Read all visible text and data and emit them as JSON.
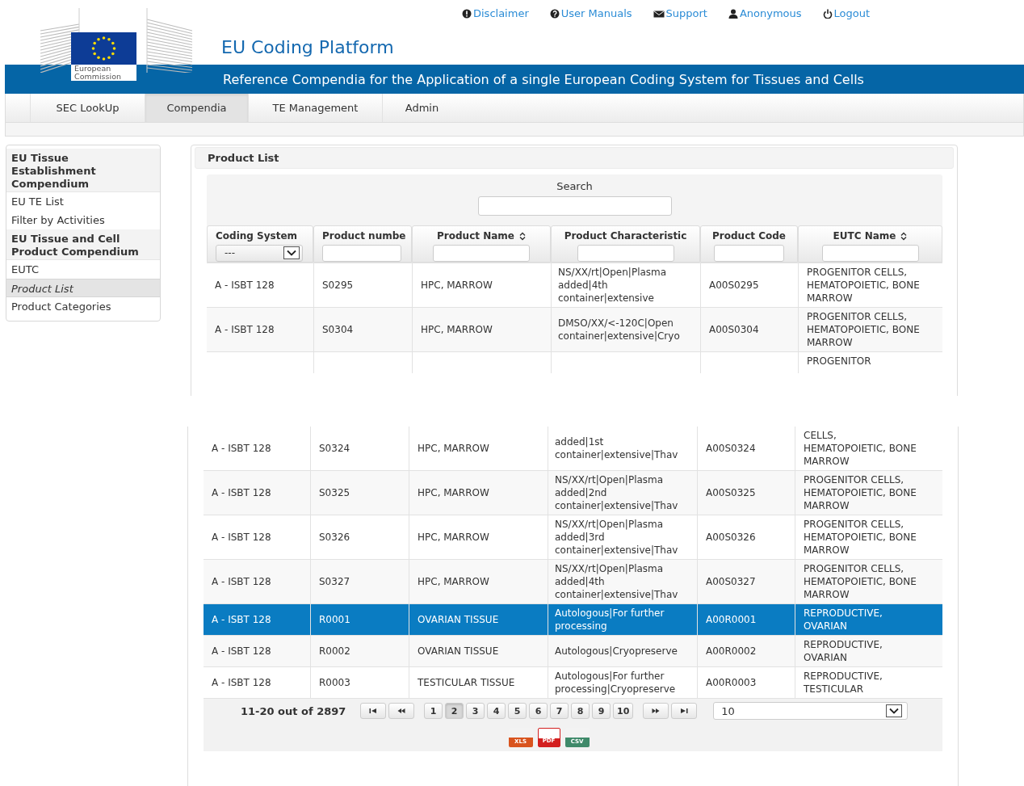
{
  "top_links": [
    {
      "kind": "alert",
      "label": "Disclaimer"
    },
    {
      "kind": "help",
      "label": "User Manuals"
    },
    {
      "kind": "mail",
      "label": "Support"
    },
    {
      "kind": "user",
      "label": "Anonymous"
    },
    {
      "kind": "power",
      "label": "Logout"
    }
  ],
  "logo": {
    "line_1": "European",
    "line_2": "Commission"
  },
  "title": "EU Coding Platform",
  "subtitle": "Reference Compendia for the Application of a single European Coding System for Tissues and Cells",
  "tabs": [
    {
      "label": "SEC LookUp",
      "selected": false
    },
    {
      "label": "Compendia",
      "selected": true
    },
    {
      "label": "TE Management",
      "selected": false
    },
    {
      "label": "Admin",
      "selected": false
    }
  ],
  "sidebar": {
    "items": [
      {
        "kind": "heading",
        "label": "EU Tissue Establishment Compendium",
        "selected": false
      },
      {
        "kind": "link",
        "label": "EU TE List",
        "selected": false
      },
      {
        "kind": "link",
        "label": "Filter by Activities",
        "selected": false
      },
      {
        "kind": "heading",
        "label": "EU Tissue and Cell Product Compendium",
        "selected": false
      },
      {
        "kind": "link",
        "label": "EUTC",
        "selected": false
      },
      {
        "kind": "link",
        "label": "Product List",
        "selected": true
      },
      {
        "kind": "link",
        "label": "Product Categories",
        "selected": false
      }
    ]
  },
  "panel": {
    "title": "Product List",
    "search": {
      "label": "Search"
    }
  },
  "table": {
    "columns": [
      {
        "label": "Coding System",
        "sortable": false,
        "filter": {
          "kind": "select",
          "value": "---"
        }
      },
      {
        "label": "Product numbe",
        "sortable": false,
        "filter": {
          "kind": "text"
        }
      },
      {
        "label": "Product Name",
        "sortable": true,
        "filter": {
          "kind": "text"
        }
      },
      {
        "label": "Product Characteristic",
        "sortable": false,
        "filter": {
          "kind": "text"
        }
      },
      {
        "label": "Product Code",
        "sortable": false,
        "filter": {
          "kind": "text"
        }
      },
      {
        "label": "EUTC Name",
        "sortable": true,
        "filter": {
          "kind": "text"
        }
      }
    ],
    "rows": [
      {
        "selected": false,
        "coding_system": "A - ISBT 128",
        "product_number": "S0295",
        "product_name": "HPC, MARROW",
        "product_characteristic": "NS/XX/rt|Open|Plasma added|4th container|extensive",
        "product_code": "A00S0295",
        "eutc_name": "PROGENITOR CELLS, HEMATOPOIETIC, BONE MARROW"
      },
      {
        "selected": false,
        "coding_system": "A - ISBT 128",
        "product_number": "S0304",
        "product_name": "HPC, MARROW",
        "product_characteristic": "DMSO/XX/<-120C|Open container|extensive|Cryo",
        "product_code": "A00S0304",
        "eutc_name": "PROGENITOR CELLS, HEMATOPOIETIC, BONE MARROW"
      },
      {
        "selected": false,
        "eutc_name": "PROGENITOR"
      }
    ]
  },
  "table_continued": {
    "rows": [
      {
        "selected": false,
        "coding_system": "A - ISBT 128",
        "product_number": "S0324",
        "product_name": "HPC, MARROW",
        "product_characteristic": "added|1st container|extensive|Thav",
        "product_code": "A00S0324",
        "eutc_name": "CELLS, HEMATOPOIETIC, BONE MARROW"
      },
      {
        "selected": false,
        "coding_system": "A - ISBT 128",
        "product_number": "S0325",
        "product_name": "HPC, MARROW",
        "product_characteristic": "NS/XX/rt|Open|Plasma added|2nd container|extensive|Thav",
        "product_code": "A00S0325",
        "eutc_name": "PROGENITOR CELLS, HEMATOPOIETIC, BONE MARROW"
      },
      {
        "selected": false,
        "coding_system": "A - ISBT 128",
        "product_number": "S0326",
        "product_name": "HPC, MARROW",
        "product_characteristic": "NS/XX/rt|Open|Plasma added|3rd container|extensive|Thav",
        "product_code": "A00S0326",
        "eutc_name": "PROGENITOR CELLS, HEMATOPOIETIC, BONE MARROW"
      },
      {
        "selected": false,
        "coding_system": "A - ISBT 128",
        "product_number": "S0327",
        "product_name": "HPC, MARROW",
        "product_characteristic": "NS/XX/rt|Open|Plasma added|4th container|extensive|Thav",
        "product_code": "A00S0327",
        "eutc_name": "PROGENITOR CELLS, HEMATOPOIETIC, BONE MARROW"
      },
      {
        "selected": true,
        "coding_system": "A - ISBT 128",
        "product_number": "R0001",
        "product_name": "OVARIAN TISSUE",
        "product_characteristic": "Autologous|For further processing",
        "product_code": "A00R0001",
        "eutc_name": "REPRODUCTIVE, OVARIAN"
      },
      {
        "selected": false,
        "coding_system": "A - ISBT 128",
        "product_number": "R0002",
        "product_name": "OVARIAN TISSUE",
        "product_characteristic": "Autologous|Cryopreserve",
        "product_code": "A00R0002",
        "eutc_name": "REPRODUCTIVE, OVARIAN"
      },
      {
        "selected": false,
        "coding_system": "A - ISBT 128",
        "product_number": "R0003",
        "product_name": "TESTICULAR TISSUE",
        "product_characteristic": "Autologous|For further processing|Cryopreserve",
        "product_code": "A00R0003",
        "eutc_name": "REPRODUCTIVE, TESTICULAR"
      }
    ]
  },
  "pagination": {
    "summary": "11-20 out of 2897",
    "pages": [
      {
        "label": "1",
        "selected": false
      },
      {
        "label": "2",
        "selected": true
      },
      {
        "label": "3",
        "selected": false
      },
      {
        "label": "4",
        "selected": false
      },
      {
        "label": "5",
        "selected": false
      },
      {
        "label": "6",
        "selected": false
      },
      {
        "label": "7",
        "selected": false
      },
      {
        "label": "8",
        "selected": false
      },
      {
        "label": "9",
        "selected": false
      },
      {
        "label": "10",
        "selected": false
      }
    ],
    "page_size": "10"
  },
  "exports": [
    {
      "kind": "xls",
      "label": "XLS"
    },
    {
      "kind": "pdf",
      "label": "PDF"
    },
    {
      "kind": "csv",
      "label": "CSV"
    }
  ]
}
